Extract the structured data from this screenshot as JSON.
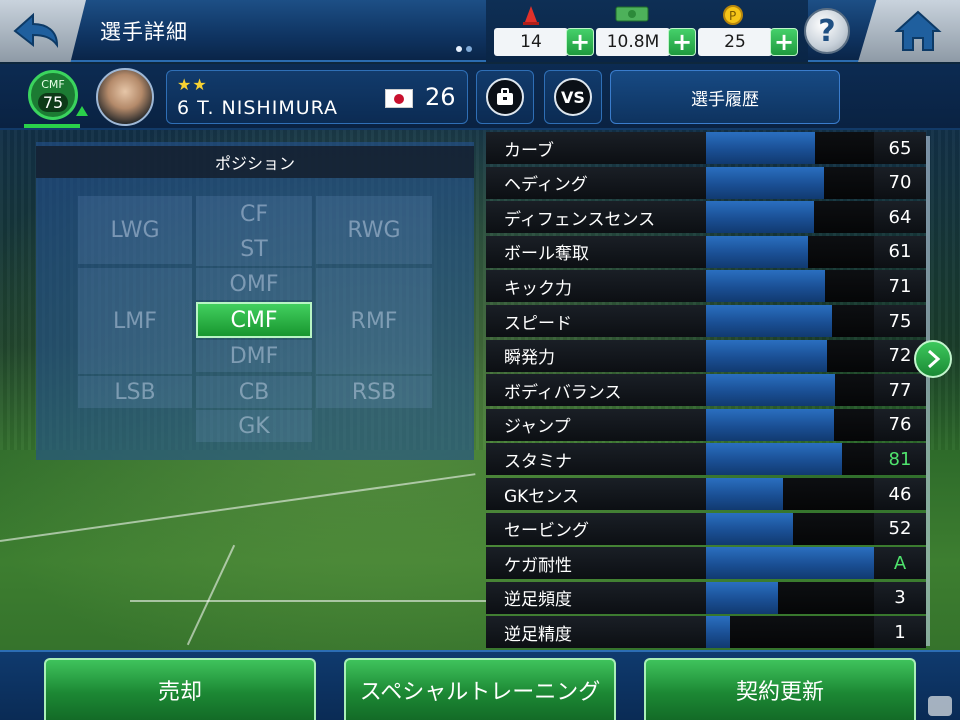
{
  "header": {
    "title": "選手詳細",
    "currencies": [
      {
        "icon": "cone-icon",
        "value": "14"
      },
      {
        "icon": "money-icon",
        "value": "10.8M"
      },
      {
        "icon": "coin-icon",
        "value": "25"
      }
    ],
    "plus_label": "+",
    "help_label": "?"
  },
  "player": {
    "position": "CMF",
    "rating": "75",
    "stars": "★★",
    "name": "6 T. NISHIMURA",
    "nationality": "Japan",
    "age": "26",
    "vs_label": "VS",
    "history_label": "選手履歴"
  },
  "position_panel": {
    "title": "ポジション",
    "positions": [
      "LWG",
      "CF",
      "ST",
      "RWG",
      "OMF",
      "LMF",
      "CMF",
      "RMF",
      "DMF",
      "LSB",
      "CB",
      "RSB",
      "GK"
    ],
    "active": "CMF"
  },
  "stats": [
    {
      "label": "カーブ",
      "value": "65",
      "fill": 0.65
    },
    {
      "label": "ヘディング",
      "value": "70",
      "fill": 0.7
    },
    {
      "label": "ディフェンスセンス",
      "value": "64",
      "fill": 0.64
    },
    {
      "label": "ボール奪取",
      "value": "61",
      "fill": 0.61
    },
    {
      "label": "キック力",
      "value": "71",
      "fill": 0.71
    },
    {
      "label": "スピード",
      "value": "75",
      "fill": 0.75
    },
    {
      "label": "瞬発力",
      "value": "72",
      "fill": 0.72
    },
    {
      "label": "ボディバランス",
      "value": "77",
      "fill": 0.77
    },
    {
      "label": "ジャンプ",
      "value": "76",
      "fill": 0.76
    },
    {
      "label": "スタミナ",
      "value": "81",
      "fill": 0.81,
      "highlight": true
    },
    {
      "label": "GKセンス",
      "value": "46",
      "fill": 0.46
    },
    {
      "label": "セービング",
      "value": "52",
      "fill": 0.52
    },
    {
      "label": "ケガ耐性",
      "value": "A",
      "fill": 1.0,
      "highlight": true
    },
    {
      "label": "逆足頻度",
      "value": "3",
      "fill": 0.43
    },
    {
      "label": "逆足精度",
      "value": "1",
      "fill": 0.14
    }
  ],
  "footer": {
    "sell_label": "売却",
    "training_label": "スペシャルトレーニング",
    "renew_label": "契約更新"
  },
  "colors": {
    "accent_green": "#2ad04a",
    "highlight_value": "#4fe36d",
    "stat_bar": "#1a4f94"
  }
}
